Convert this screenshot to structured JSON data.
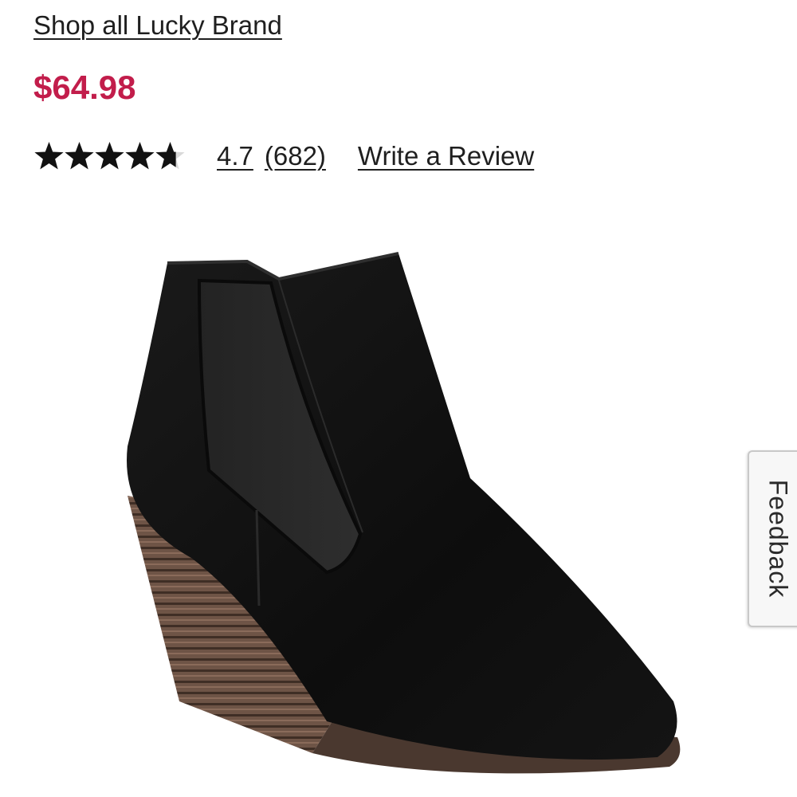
{
  "product": {
    "brand_link": "Shop all Lucky Brand",
    "price": "$64.98",
    "price_color": "#c21d4b",
    "rating": {
      "stars_value": 4.7,
      "stars_max": 5,
      "score": "4.7",
      "count": "(682)",
      "write_review": "Write a Review"
    },
    "image": {
      "alt": "black suede wedge ankle boot",
      "icon": "product-photo"
    }
  },
  "feedback": {
    "label": "Feedback"
  }
}
